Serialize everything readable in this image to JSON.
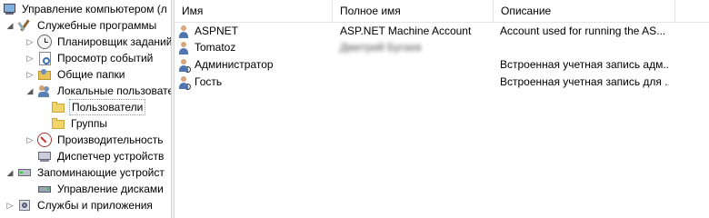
{
  "tree": {
    "root": "Управление компьютером (л",
    "system_tools": "Служебные программы",
    "task_scheduler": "Планировщик заданий",
    "event_viewer": "Просмотр событий",
    "shared_folders": "Общие папки",
    "local_users": "Локальные пользовате",
    "users": "Пользователи",
    "groups": "Группы",
    "performance": "Производительность",
    "device_manager": "Диспетчер устройств",
    "storage": "Запоминающие устройст",
    "disk_management": "Управление дисками",
    "services": "Службы и приложения"
  },
  "columns": {
    "name": "Имя",
    "full_name": "Полное имя",
    "description": "Описание"
  },
  "rows": [
    {
      "name": "ASPNET",
      "full_name": "ASP.NET Machine Account",
      "description": "Account used for running the AS...",
      "icon": "user-icon"
    },
    {
      "name": "Tomatoz",
      "full_name": "Дмитрий Бугаев",
      "description": "",
      "icon": "user-icon",
      "full_name_blurred": true
    },
    {
      "name": "Администратор",
      "full_name": "",
      "description": "Встроенная учетная запись адм...",
      "icon": "user-disabled-icon"
    },
    {
      "name": "Гость",
      "full_name": "",
      "description": "Встроенная учетная запись для ...",
      "icon": "user-disabled-icon"
    }
  ]
}
